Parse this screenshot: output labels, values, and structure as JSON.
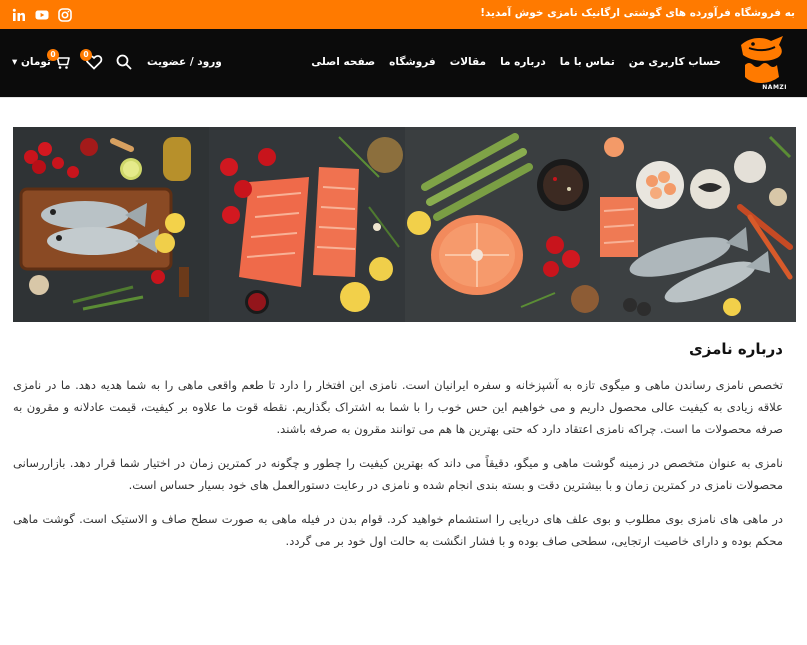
{
  "topbar": {
    "promo": "به فروشگاه فرآورده های گوشتی ارگانیک نامزی خوش آمدید!",
    "social": [
      "linkedin-icon",
      "youtube-icon",
      "instagram-icon"
    ]
  },
  "brand": {
    "logo_text": "نامزی",
    "logo_subtext": "NAMZI"
  },
  "nav": {
    "items": [
      "صفحه اصلی",
      "فروشگاه",
      "مقالات",
      "درباره ما",
      "تماس با ما",
      "حساب کاربری من"
    ]
  },
  "account": {
    "login": "ورود / عضویت"
  },
  "wishlist": {
    "count": "0"
  },
  "cart": {
    "count": "0"
  },
  "currency": {
    "label": "تومان"
  },
  "colors": {
    "accent": "#ff7a00",
    "header_bg": "#0b0b0b"
  },
  "about": {
    "title": "درباره نامزی",
    "paragraphs": [
      "تخصص نامزی رساندن ماهی و میگوی تازه به آشپزخانه و سفره ایرانیان است. نامزی این افتخار را دارد تا طعم واقعی ماهی را به شما هدیه دهد. ما در نامزی علاقه زیادی به کیفیت عالی محصول داریم و می خواهیم این حس خوب را با شما به اشتراک بگذاریم. نقطه قوت ما علاوه بر کیفیت، قیمت عادلانه و مقرون به صرفه محصولات ما است. چراکه نامزی اعتقاد دارد که حتی بهترین ها هم می توانند مقرون به صرفه باشند.",
      "نامزی به عنوان متخصص در زمینه گوشت ماهی و میگو، دقیقاً می داند که بهترین کیفیت را چطور و چگونه در کمترین زمان در اختیار شما قرار دهد. بازاررسانی محصولات نامزی در کمترین زمان و با بیشترین دقت و بسته بندی انجام شده و نامزی در رعایت دستورالعمل های خود بسیار حساس است.",
      "در ماهی های نامزی بوی مطلوب و بوی علف های دریایی را استشمام خواهید کرد. قوام بدن در فیله ماهی به صورت سطح صاف و الاستیک است. گوشت ماهی محکم بوده و دارای خاصیت ارتجایی، سطحی صاف بوده و با فشار انگشت به حالت اول خود بر می گردد."
    ]
  }
}
